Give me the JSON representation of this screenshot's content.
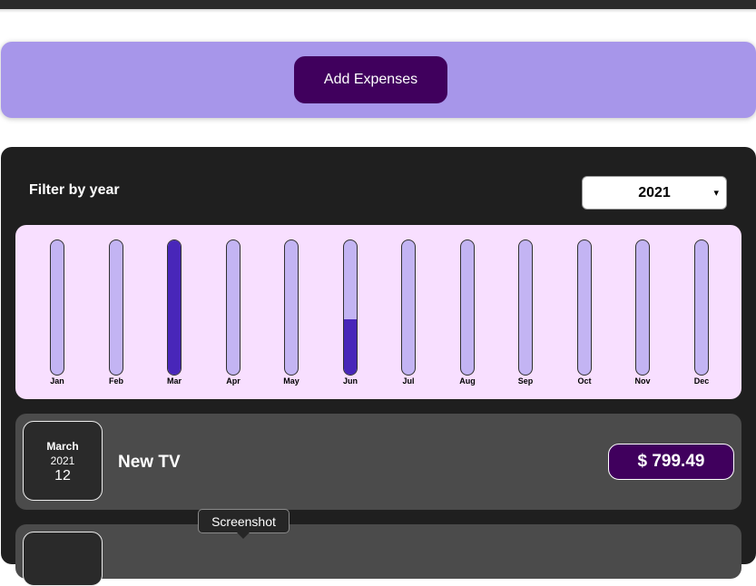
{
  "add_expense": {
    "button_label": "Add Expenses"
  },
  "filter": {
    "label": "Filter by year",
    "selected_year": "2021"
  },
  "chart_data": {
    "type": "bar",
    "categories": [
      "Jan",
      "Feb",
      "Mar",
      "Apr",
      "May",
      "Jun",
      "Jul",
      "Aug",
      "Sep",
      "Oct",
      "Nov",
      "Dec"
    ],
    "values": [
      0,
      0,
      1.0,
      0,
      0,
      0.41,
      0,
      0,
      0,
      0,
      0,
      0
    ],
    "ylim": [
      0,
      1
    ],
    "colors": {
      "track": "#c3b4f3",
      "fill": "#4826b9"
    }
  },
  "expenses": [
    {
      "month": "March",
      "year": "2021",
      "day": "12",
      "title": "New TV",
      "amount": "$ 799.49"
    }
  ],
  "tooltip": {
    "text": "Screenshot"
  }
}
